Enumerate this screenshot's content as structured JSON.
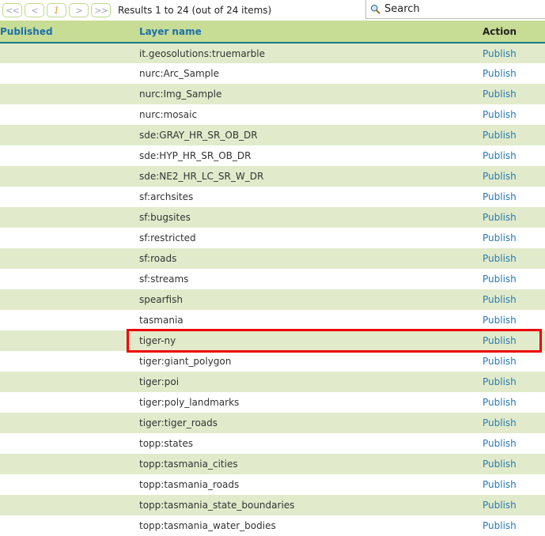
{
  "toolbar": {
    "pager": [
      {
        "name": "first-page",
        "label": "<<"
      },
      {
        "name": "prev-page",
        "label": "<"
      },
      {
        "name": "current-page",
        "label": "1"
      },
      {
        "name": "next-page",
        "label": ">"
      },
      {
        "name": "last-page",
        "label": ">>"
      }
    ],
    "results_text": "Results 1 to 24 (out of 24 items)",
    "search": {
      "icon": "search-icon",
      "value": "",
      "placeholder": "Search"
    }
  },
  "table": {
    "columns": [
      {
        "key": "published",
        "label": "Published",
        "sortable": true
      },
      {
        "key": "layer_name",
        "label": "Layer name",
        "sortable": true
      },
      {
        "key": "action",
        "label": "Action",
        "sortable": false
      }
    ],
    "action_label": "Publish",
    "rows": [
      {
        "published": "",
        "layer_name": "it.geosolutions:truemarble",
        "action": "Publish"
      },
      {
        "published": "",
        "layer_name": "nurc:Arc_Sample",
        "action": "Publish"
      },
      {
        "published": "",
        "layer_name": "nurc:Img_Sample",
        "action": "Publish"
      },
      {
        "published": "",
        "layer_name": "nurc:mosaic",
        "action": "Publish"
      },
      {
        "published": "",
        "layer_name": "sde:GRAY_HR_SR_OB_DR",
        "action": "Publish"
      },
      {
        "published": "",
        "layer_name": "sde:HYP_HR_SR_OB_DR",
        "action": "Publish"
      },
      {
        "published": "",
        "layer_name": "sde:NE2_HR_LC_SR_W_DR",
        "action": "Publish"
      },
      {
        "published": "",
        "layer_name": "sf:archsites",
        "action": "Publish"
      },
      {
        "published": "",
        "layer_name": "sf:bugsites",
        "action": "Publish"
      },
      {
        "published": "",
        "layer_name": "sf:restricted",
        "action": "Publish"
      },
      {
        "published": "",
        "layer_name": "sf:roads",
        "action": "Publish"
      },
      {
        "published": "",
        "layer_name": "sf:streams",
        "action": "Publish"
      },
      {
        "published": "",
        "layer_name": "spearfish",
        "action": "Publish"
      },
      {
        "published": "",
        "layer_name": "tasmania",
        "action": "Publish"
      },
      {
        "published": "",
        "layer_name": "tiger-ny",
        "action": "Publish",
        "highlighted": true
      },
      {
        "published": "",
        "layer_name": "tiger:giant_polygon",
        "action": "Publish"
      },
      {
        "published": "",
        "layer_name": "tiger:poi",
        "action": "Publish"
      },
      {
        "published": "",
        "layer_name": "tiger:poly_landmarks",
        "action": "Publish"
      },
      {
        "published": "",
        "layer_name": "tiger:tiger_roads",
        "action": "Publish"
      },
      {
        "published": "",
        "layer_name": "topp:states",
        "action": "Publish"
      },
      {
        "published": "",
        "layer_name": "topp:tasmania_cities",
        "action": "Publish"
      },
      {
        "published": "",
        "layer_name": "topp:tasmania_roads",
        "action": "Publish"
      },
      {
        "published": "",
        "layer_name": "topp:tasmania_state_boundaries",
        "action": "Publish"
      },
      {
        "published": "",
        "layer_name": "topp:tasmania_water_bodies",
        "action": "Publish"
      }
    ]
  },
  "colors": {
    "header_bg": "#c7dd95",
    "row_odd_bg": "#e1ebcb",
    "row_even_bg": "#ffffff",
    "header_link": "#1f6fa8",
    "publish_link": "#2a7ab0",
    "header_rule": "#1b7a83",
    "highlight_outline": "#ee0000",
    "pager_border": "#bcd98a",
    "page_number": "#d9a441"
  }
}
